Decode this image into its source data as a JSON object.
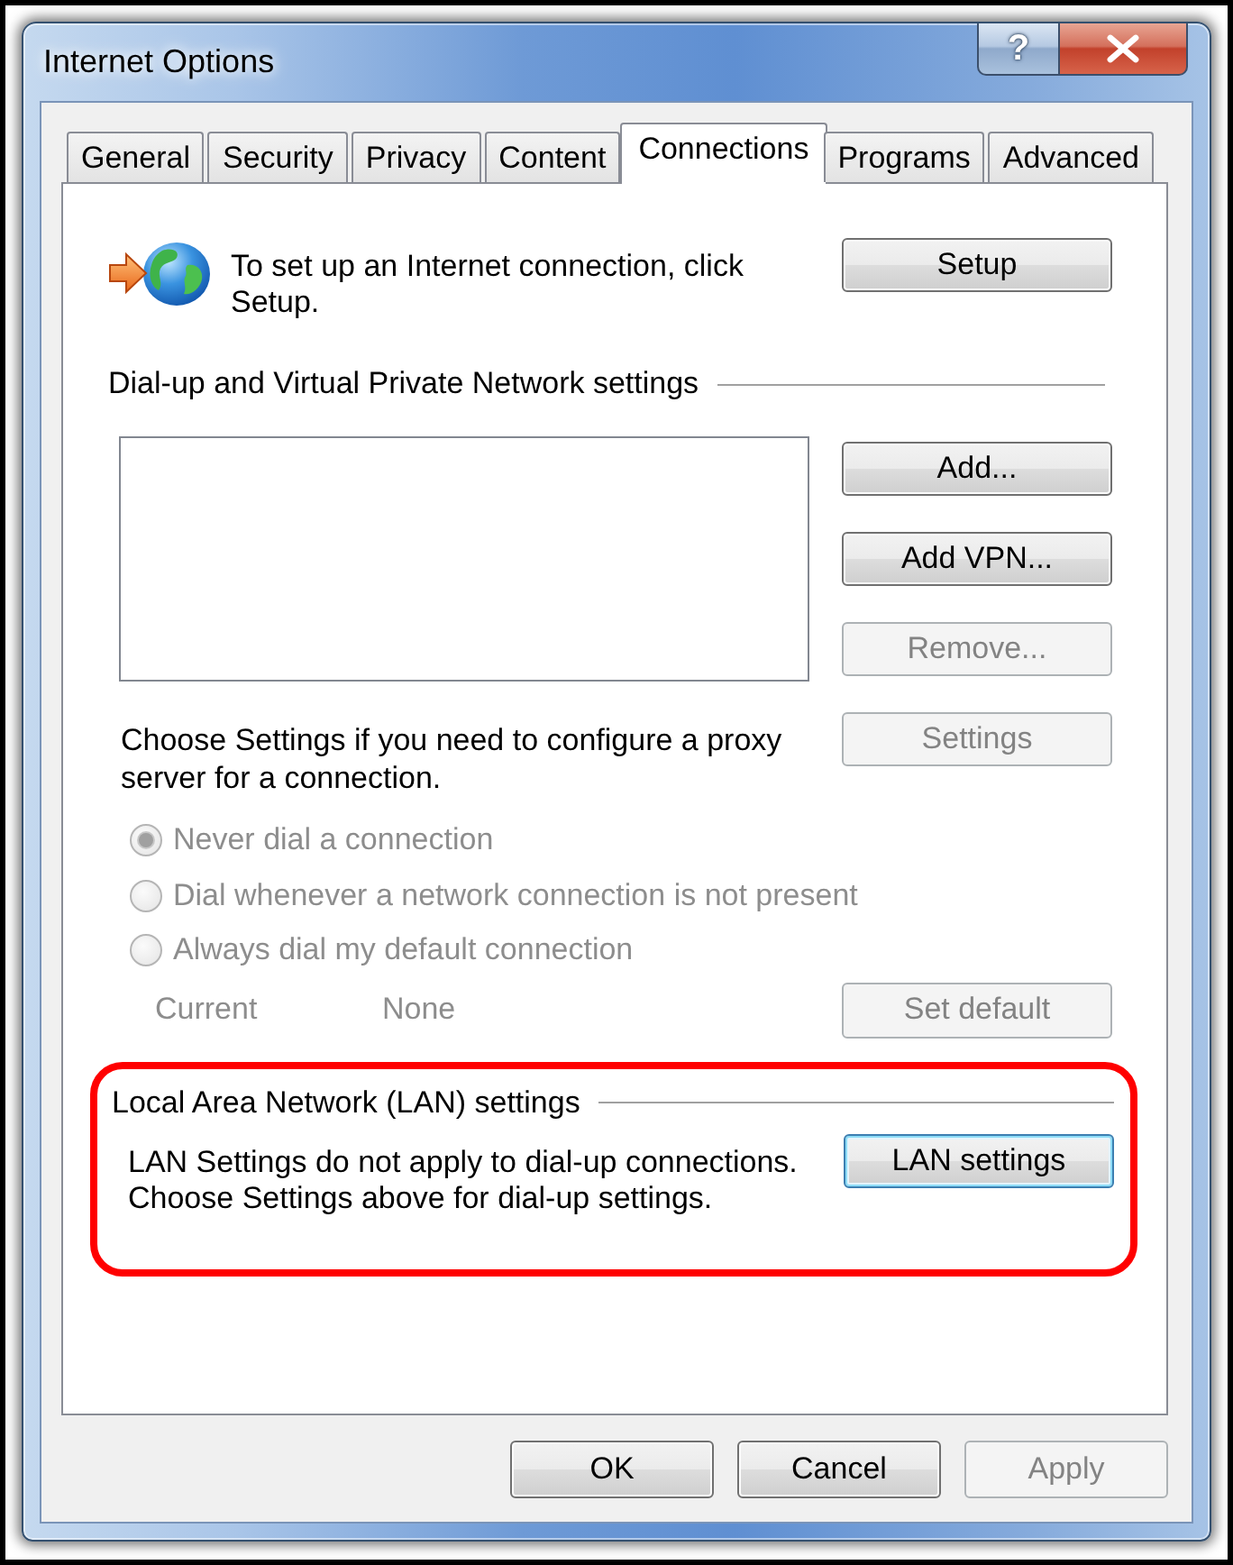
{
  "window": {
    "title": "Internet Options",
    "help_button": "?"
  },
  "tabs": [
    {
      "label": "General",
      "selected": false
    },
    {
      "label": "Security",
      "selected": false
    },
    {
      "label": "Privacy",
      "selected": false
    },
    {
      "label": "Content",
      "selected": false
    },
    {
      "label": "Connections",
      "selected": true
    },
    {
      "label": "Programs",
      "selected": false
    },
    {
      "label": "Advanced",
      "selected": false
    }
  ],
  "setup": {
    "text": "To set up an Internet connection, click Setup.",
    "button": {
      "label": "Setup",
      "disabled": false
    }
  },
  "dialup": {
    "heading": "Dial-up and Virtual Private Network settings",
    "buttons": [
      {
        "label": "Add...",
        "disabled": false
      },
      {
        "label": "Add VPN...",
        "disabled": false
      },
      {
        "label": "Remove...",
        "disabled": true
      },
      {
        "label": "Settings",
        "disabled": true
      }
    ],
    "proxy_text": "Choose Settings if you need to configure a proxy server for a connection.",
    "dial_options": [
      {
        "label": "Never dial a connection",
        "selected": true,
        "disabled": true
      },
      {
        "label": "Dial whenever a network connection is not present",
        "selected": false,
        "disabled": true
      },
      {
        "label": "Always dial my default connection",
        "selected": false,
        "disabled": true
      }
    ],
    "current": {
      "label": "Current",
      "value": "None",
      "disabled": true
    },
    "set_default_button": {
      "label": "Set default",
      "disabled": true
    }
  },
  "lan": {
    "heading": "Local Area Network (LAN) settings",
    "highlighted": true,
    "text": "LAN Settings do not apply to dial-up connections. Choose Settings above for dial-up settings.",
    "button": {
      "label": "LAN settings",
      "disabled": false,
      "focused": true
    }
  },
  "footer_buttons": [
    {
      "label": "OK",
      "disabled": false
    },
    {
      "label": "Cancel",
      "disabled": false
    },
    {
      "label": "Apply",
      "disabled": true
    }
  ]
}
